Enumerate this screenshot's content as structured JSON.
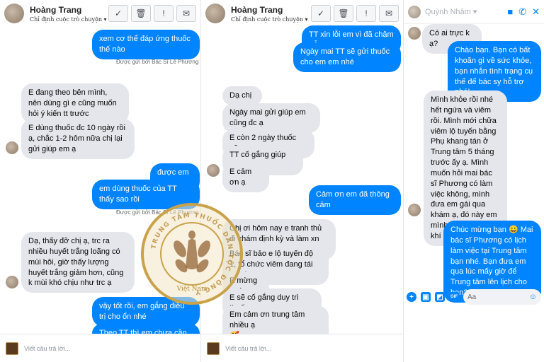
{
  "panel1": {
    "header": {
      "name": "Hoàng Trang",
      "subtitle": "Chỉ định cuộc trò chuyện"
    },
    "messages": [
      "xem cơ thể đáp ứng thuốc thế nào",
      "E đang theo bên mình, nên dùng gì e cũng muốn hỏi ý kiến tt trước",
      "E dùng thuốc đc 10 ngày rồi ạ, chắc 1-2 hôm nữa chị lại gửi giúp em ạ",
      "được em nhé",
      "em dùng thuốc của TT thấy sao rồi",
      "Dạ, thấy đỡ chị ạ, trc ra nhiều huyết trắng loãng có mùi hôi, giờ thấy lượng huyết trắng giảm hơn, cũng k mùi khó chịu như trc ạ",
      "vậy tốt rồi, em gắng điều trị cho ổn nhé",
      "Theo TT thì em chưa cần"
    ],
    "sent_by": "Được gửi bởi Bác Sĩ Lê Phương",
    "reply_placeholder": "Viết câu trả lời..."
  },
  "panel2": {
    "header": {
      "name": "Hoàng Trang",
      "subtitle": "Chỉ định cuộc trò chuyện"
    },
    "messages": [
      "TT xin lỗi em vì đã chậm trễ",
      "Ngày mai TT sẽ gửi thuốc cho em em nhé",
      "Dạ chị",
      "Ngày mai gửi giúp em cũng đc ạ",
      "E còn 2 ngày thuốc nữa",
      "TT cố gắng giúp em",
      "E cảm ơn ạ",
      "Cảm ơn em đã thông cảm",
      "Chị ơi hôm nay e tranh thủ đi khám định kỳ và làm xn pap",
      "Bác sĩ bảo e lộ tuyến độ 1, tổ chức viêm đang tái tạo rồi ạ",
      "E mừng quá",
      "E sẽ cố gắng duy trì thuốc",
      "Em cảm ơn trung tâm nhiều ạ",
      "🥰"
    ],
    "reply_placeholder": "Viết câu trả lời..."
  },
  "panel3": {
    "header": {
      "name": "Quỳnh Nhâm"
    },
    "messages": [
      "Có ai trực k ạ?",
      "Chào bạn. Bạn có bất khoăn gì về sức khỏe, bạn nhắn tình trạng cụ thể để bác sy hỗ trợ nhé!",
      "Mình khỏe rồi nhé hết ngứa và viêm rồi. Mình mới chữa viêm lộ tuyến bằng Phụ khang tán ở Trung tâm 5 tháng trước ấy ạ. Mình muốn hỏi mai bác sĩ Phương có làm việc không, mình đưa em gái qua khám ạ, đó này em mình bị ngứa với ra khí hư hôi ạ",
      "Chúc mừng bạn 😀 Mai bác sĩ Phương có lịch làm việc tại Trung tâm bạn nhé. Bạn đưa em qua lúc mấy giờ để Trung tâm lên lịch cho bạn?"
    ],
    "composer_placeholder": "Aa"
  },
  "watermark": {
    "ring_text": "TRUNG TÂM THUỐC DÂN TỘC ĐÔNG Y",
    "bottom_text": "Việt Nam"
  },
  "colors": {
    "accent": "#0084ff",
    "incoming": "#e4e6eb",
    "gold": "#c9a24a"
  }
}
